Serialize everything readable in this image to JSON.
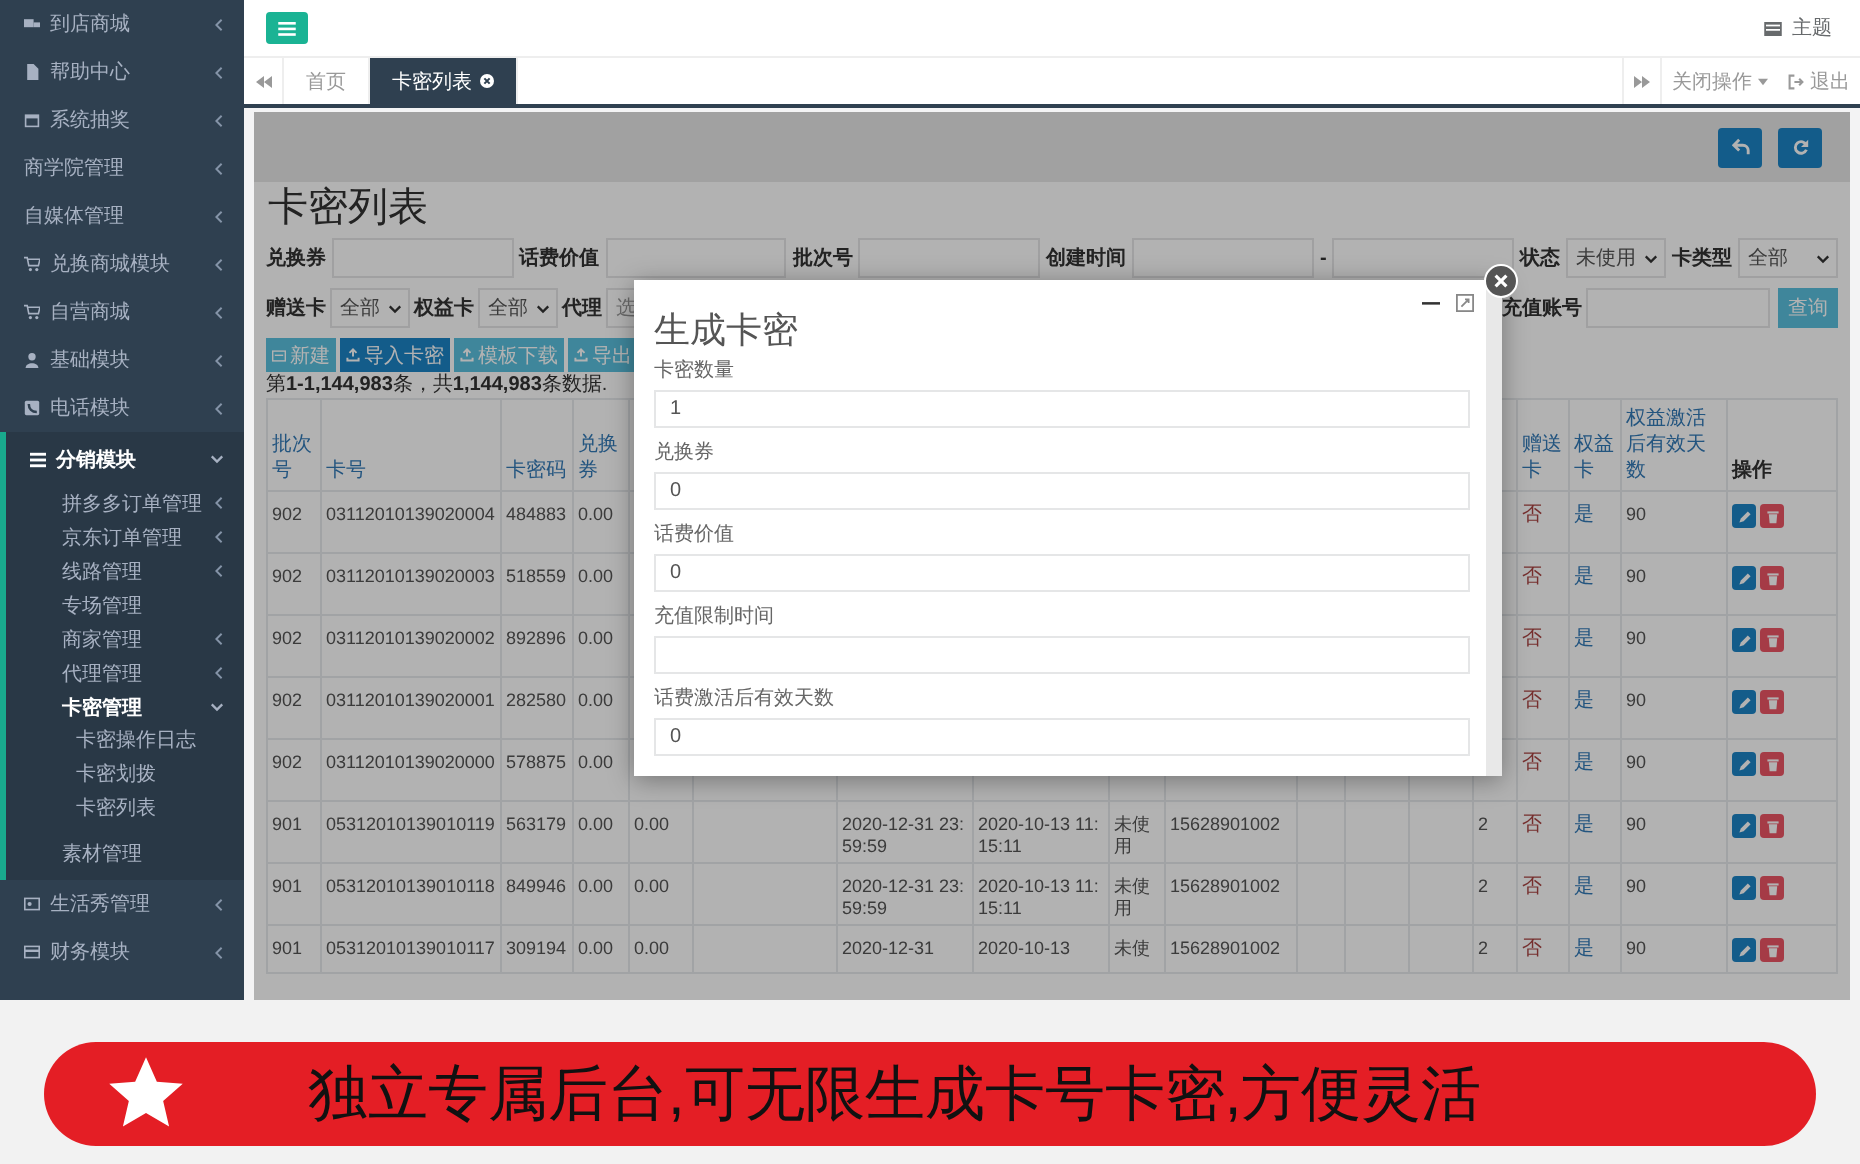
{
  "sidebar": {
    "items": [
      {
        "label": "到店商城",
        "kind": "group",
        "expanded": false
      },
      {
        "label": "帮助中心",
        "kind": "group",
        "expanded": false
      },
      {
        "label": "系统抽奖",
        "kind": "group",
        "expanded": false
      },
      {
        "label": "商学院管理",
        "kind": "group",
        "expanded": false
      },
      {
        "label": "自媒体管理",
        "kind": "group",
        "expanded": false
      },
      {
        "label": "兑换商城模块",
        "kind": "group",
        "expanded": false
      },
      {
        "label": "自营商城",
        "kind": "group",
        "expanded": false
      },
      {
        "label": "基础模块",
        "kind": "group",
        "expanded": false
      },
      {
        "label": "电话模块",
        "kind": "group",
        "expanded": false
      },
      {
        "label": "分销模块",
        "kind": "group",
        "expanded": true,
        "children": [
          {
            "label": "拼多多订单管理",
            "kind": "group",
            "expanded": false
          },
          {
            "label": "京东订单管理",
            "kind": "group",
            "expanded": false
          },
          {
            "label": "线路管理",
            "kind": "group",
            "expanded": false
          },
          {
            "label": "专场管理",
            "kind": "link"
          },
          {
            "label": "商家管理",
            "kind": "group",
            "expanded": false
          },
          {
            "label": "代理管理",
            "kind": "group",
            "expanded": false
          },
          {
            "label": "卡密管理",
            "kind": "group",
            "expanded": true,
            "children": [
              {
                "label": "卡密操作日志"
              },
              {
                "label": "卡密划拨"
              },
              {
                "label": "卡密列表"
              }
            ]
          },
          {
            "label": "素材管理",
            "kind": "link"
          }
        ]
      },
      {
        "label": "生活秀管理",
        "kind": "group",
        "expanded": false
      },
      {
        "label": "财务模块",
        "kind": "group",
        "expanded": false
      }
    ]
  },
  "header": {
    "theme_label": "主题"
  },
  "tabs": [
    {
      "label": "首页",
      "selected": false,
      "closable": false
    },
    {
      "label": "卡密列表",
      "selected": true,
      "closable": true
    }
  ],
  "tab_actions": {
    "close_menu": "关闭操作",
    "logout": "退出"
  },
  "page": {
    "title": "卡密列表",
    "filters_row1": [
      {
        "label": "兑换券",
        "kind": "input"
      },
      {
        "label": "话费价值",
        "kind": "input"
      },
      {
        "label": "批次号",
        "kind": "input"
      },
      {
        "label": "创建时间",
        "kind": "range",
        "separator": "-"
      },
      {
        "label": "状态",
        "kind": "select",
        "value": "未使用"
      },
      {
        "label": "卡类型",
        "kind": "select",
        "value": "全部"
      }
    ],
    "filters_row2": [
      {
        "label": "赠送卡",
        "kind": "select",
        "value": "全部"
      },
      {
        "label": "权益卡",
        "kind": "select",
        "value": "全部"
      },
      {
        "label": "代理",
        "kind": "wide-select",
        "placeholder": "选"
      }
    ],
    "account_filter": {
      "label": "充值账号"
    },
    "query_button": "查询",
    "actions": [
      {
        "label": "新建",
        "kind": "info"
      },
      {
        "label": "导入卡密",
        "kind": "primary"
      },
      {
        "label": "模板下载",
        "kind": "info"
      },
      {
        "label": "导出",
        "kind": "info"
      }
    ],
    "summary": "第**1-1,144,983**条，共**1,144,983**条数据."
  },
  "table": {
    "columns": [
      {
        "label": "批次号",
        "sortable": true
      },
      {
        "label": "卡号",
        "sortable": true
      },
      {
        "label": "卡密码",
        "sortable": true
      },
      {
        "label": "兑换券",
        "sortable": true
      }
    ],
    "right_columns": [
      {
        "label": "赠送卡",
        "sortable": true
      },
      {
        "label": "权益卡",
        "sortable": true
      },
      {
        "label": "权益激活后有效天数",
        "sortable": true
      },
      {
        "label": "操作",
        "sortable": false
      }
    ],
    "rows": [
      {
        "cells": [
          "902",
          "03112010139020004",
          "484883",
          "0.00",
          null,
          null,
          null,
          null,
          null,
          null,
          null,
          null,
          null,
          null,
          "否",
          "是",
          "90"
        ]
      },
      {
        "cells": [
          "902",
          "03112010139020003",
          "518559",
          "0.00",
          null,
          null,
          null,
          null,
          null,
          null,
          null,
          null,
          null,
          null,
          "否",
          "是",
          "90"
        ]
      },
      {
        "cells": [
          "902",
          "03112010139020002",
          "892896",
          "0.00",
          null,
          null,
          null,
          null,
          null,
          null,
          null,
          null,
          null,
          null,
          "否",
          "是",
          "90"
        ]
      },
      {
        "cells": [
          "902",
          "03112010139020001",
          "282580",
          "0.00",
          null,
          null,
          null,
          null,
          null,
          null,
          null,
          null,
          null,
          null,
          "否",
          "是",
          "90"
        ]
      },
      {
        "cells": [
          "902",
          "03112010139020000",
          "578875",
          "0.00",
          null,
          null,
          null,
          null,
          null,
          null,
          null,
          null,
          null,
          null,
          "否",
          "是",
          "90"
        ]
      },
      {
        "cells": [
          "901",
          "05312010139010119",
          "563179",
          "0.00",
          "0.00",
          null,
          "2020-12-31 23:59:59",
          "2020-10-13 11:15:11",
          "未使用",
          "15628901002",
          null,
          null,
          null,
          "2",
          "否",
          "是",
          "90"
        ]
      },
      {
        "cells": [
          "901",
          "05312010139010118",
          "849946",
          "0.00",
          "0.00",
          null,
          "2020-12-31 23:59:59",
          "2020-10-13 11:15:11",
          "未使用",
          "15628901002",
          null,
          null,
          null,
          "2",
          "否",
          "是",
          "90"
        ]
      },
      {
        "cells": [
          "901",
          "05312010139010117",
          "309194",
          "0.00",
          "0.00",
          null,
          "2020-12-31",
          "2020-10-13",
          "未使",
          "15628901002",
          null,
          null,
          null,
          "2",
          "否",
          "是",
          "90"
        ]
      }
    ]
  },
  "modal": {
    "title": "生成卡密",
    "fields": [
      {
        "label": "卡密数量",
        "value": "1"
      },
      {
        "label": "兑换券",
        "value": "0"
      },
      {
        "label": "话费价值",
        "value": "0"
      },
      {
        "label": "充值限制时间"
      },
      {
        "label": "话费激活后有效天数",
        "value": "0"
      }
    ]
  },
  "banner": {
    "text": "独立专属后台,可无限生成卡号卡密,方便灵活"
  }
}
